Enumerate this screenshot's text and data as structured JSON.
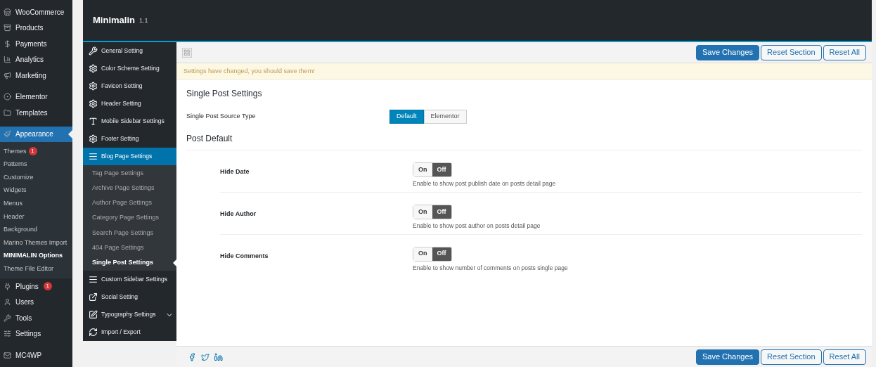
{
  "wp_menu": [
    {
      "label": "WooCommerce",
      "selected": false
    },
    {
      "label": "Products",
      "selected": false
    },
    {
      "label": "Payments",
      "selected": false
    },
    {
      "label": "Analytics",
      "selected": false
    },
    {
      "label": "Marketing",
      "selected": false
    },
    {
      "label": "Elementor",
      "selected": false
    },
    {
      "label": "Templates",
      "selected": false
    },
    {
      "label": "Appearance",
      "selected": true,
      "children": [
        {
          "label": "Themes",
          "badge": "1",
          "selected": false
        },
        {
          "label": "Patterns",
          "selected": false
        },
        {
          "label": "Customize",
          "selected": false
        },
        {
          "label": "Widgets",
          "selected": false
        },
        {
          "label": "Menus",
          "selected": false
        },
        {
          "label": "Header",
          "selected": false
        },
        {
          "label": "Background",
          "selected": false
        },
        {
          "label": "Marino Themes Import",
          "selected": false
        },
        {
          "label": "MINIMALIN Options",
          "selected": true
        },
        {
          "label": "Theme File Editor",
          "selected": false
        }
      ]
    },
    {
      "label": "Plugins",
      "badge": "1",
      "selected": false
    },
    {
      "label": "Users",
      "selected": false
    },
    {
      "label": "Tools",
      "selected": false
    },
    {
      "label": "Settings",
      "selected": false
    },
    {
      "label": "MC4WP",
      "selected": false
    }
  ],
  "panel": {
    "title": "Minimalin",
    "version": "1.1",
    "nav": [
      {
        "label": "General Setting",
        "selected": false
      },
      {
        "label": "Color Scheme Setting",
        "selected": false
      },
      {
        "label": "Favicon Setting",
        "selected": false
      },
      {
        "label": "Header Setting",
        "selected": false
      },
      {
        "label": "Mobile Sidebar Settings",
        "selected": false
      },
      {
        "label": "Footer Setting",
        "selected": false
      },
      {
        "label": "Blog Page Settings",
        "selected": true,
        "children": [
          {
            "label": "Tag Page Settings",
            "selected": false
          },
          {
            "label": "Archive Page Settings",
            "selected": false
          },
          {
            "label": "Author Page Settings",
            "selected": false
          },
          {
            "label": "Category Page Settings",
            "selected": false
          },
          {
            "label": "Search Page Settings",
            "selected": false
          },
          {
            "label": "404 Page Settings",
            "selected": false
          },
          {
            "label": "Single Post Settings",
            "selected": true
          }
        ]
      },
      {
        "label": "Custom Sidebar Settings",
        "selected": false
      },
      {
        "label": "Social Setting",
        "selected": false
      },
      {
        "label": "Typography Settings",
        "selected": false,
        "expandable": true
      },
      {
        "label": "Import / Export",
        "selected": false
      }
    ],
    "buttons": [
      "Save Changes",
      "Reset Section",
      "Reset All"
    ],
    "notice": "Settings have changed, you should save them!",
    "section_title": "Single Post Settings",
    "source_type": {
      "label": "Single Post Source Type",
      "options": [
        {
          "label": "Default",
          "selected": true
        },
        {
          "label": "Elementor",
          "selected": false
        }
      ]
    },
    "group_title": "Post Default",
    "toggles": [
      {
        "label": "Hide Date",
        "on_label": "On",
        "off_label": "Off",
        "on": false,
        "description": "Enable to show post publish date on posts detail page"
      },
      {
        "label": "Hide Author",
        "on_label": "On",
        "off_label": "Off",
        "on": false,
        "description": "Enable to show post author on posts detail page"
      },
      {
        "label": "Hide Comments",
        "on_label": "On",
        "off_label": "Off",
        "on": false,
        "description": "Enable to show number of comments on posts single page"
      }
    ],
    "footer_buttons": [
      "Save Changes",
      "Reset Section",
      "Reset All"
    ]
  }
}
